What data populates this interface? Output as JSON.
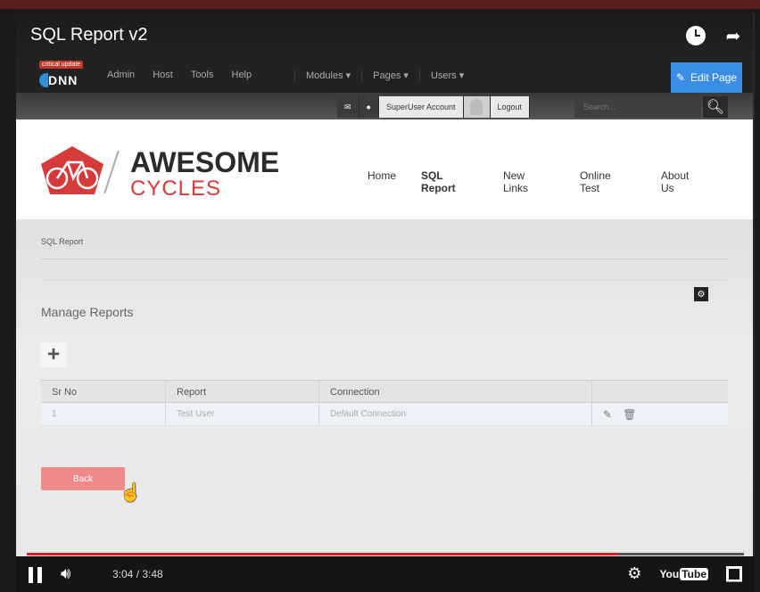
{
  "video": {
    "title": "SQL Report v2",
    "time_current": "3:04",
    "time_total": "3:48",
    "time_display": "3:04 / 3:48",
    "progress_fraction": 0.825,
    "youtube_logo_a": "You",
    "youtube_logo_b": "Tube",
    "progress_color": "#e21b1b"
  },
  "dnn_bar": {
    "badge": "critical update",
    "logo": "DNN",
    "menu_left": [
      "Admin",
      "Host",
      "Tools",
      "Help"
    ],
    "menu_right": [
      "Modules ▾",
      "Pages ▾",
      "Users ▾"
    ],
    "edit_page": "Edit Page",
    "accent": "#3a8ee6"
  },
  "user_bar": {
    "account": "SuperUser Account",
    "logout": "Logout",
    "search_placeholder": "Search..."
  },
  "site": {
    "brand_top": "AWESOME",
    "brand_bottom": "CYCLES",
    "brand_color": "#d63b3b",
    "nav": [
      {
        "label": "Home",
        "active": false
      },
      {
        "label": "SQL Report",
        "active": true
      },
      {
        "label": "New Links",
        "active": false
      },
      {
        "label": "Online Test",
        "active": false
      },
      {
        "label": "About Us",
        "active": false
      }
    ]
  },
  "page": {
    "breadcrumb": "SQL Report",
    "heading": "Manage Reports",
    "table": {
      "headers": [
        "Sr No",
        "Report",
        "Connection",
        ""
      ],
      "rows": [
        {
          "sr_no": "1",
          "report": "Test User",
          "connection": "Default Connection"
        }
      ]
    },
    "back_label": "Back",
    "back_color": "#ee8a8a"
  }
}
